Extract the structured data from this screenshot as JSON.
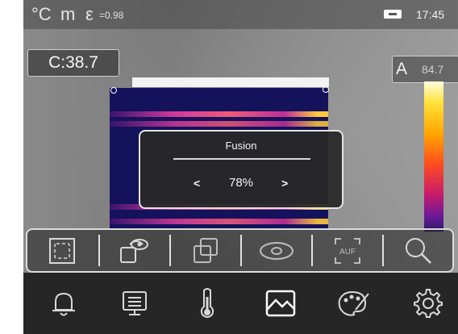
{
  "status_bar": {
    "unit_celsius": "°C",
    "unit_m": "m",
    "unit_epsilon": "ε",
    "emissivity": "=0.98",
    "battery_icon": "battery-icon",
    "time": "17:45"
  },
  "readouts": {
    "center": "C:38.7",
    "auto_label": "A",
    "auto_value": "84.7"
  },
  "fusion_dialog": {
    "title": "Fusion",
    "prev_label": "<",
    "value": "78%",
    "next_label": ">",
    "level": 0.78
  },
  "toolbar": {
    "items": [
      {
        "icon": "area-frame-icon"
      },
      {
        "icon": "picture-in-picture-eye-icon"
      },
      {
        "icon": "overlap-squares-icon"
      },
      {
        "icon": "eye-icon"
      },
      {
        "icon": "auto-focus-icon",
        "label": "AUF"
      },
      {
        "icon": "zoom-search-icon"
      }
    ]
  },
  "bottom_nav": {
    "items": [
      {
        "icon": "alarm-bell-icon"
      },
      {
        "icon": "monitor-display-icon"
      },
      {
        "icon": "thermometer-icon"
      },
      {
        "icon": "image-mode-icon",
        "selected": true
      },
      {
        "icon": "color-palette-icon"
      },
      {
        "icon": "settings-gear-icon"
      }
    ]
  },
  "colors": {
    "panel_dark": "#262626",
    "popup_bg": "#282828",
    "thermal_bg": "#13125a",
    "icon_stroke": "#d9d9d9",
    "selected_icon": "#ffffff"
  }
}
